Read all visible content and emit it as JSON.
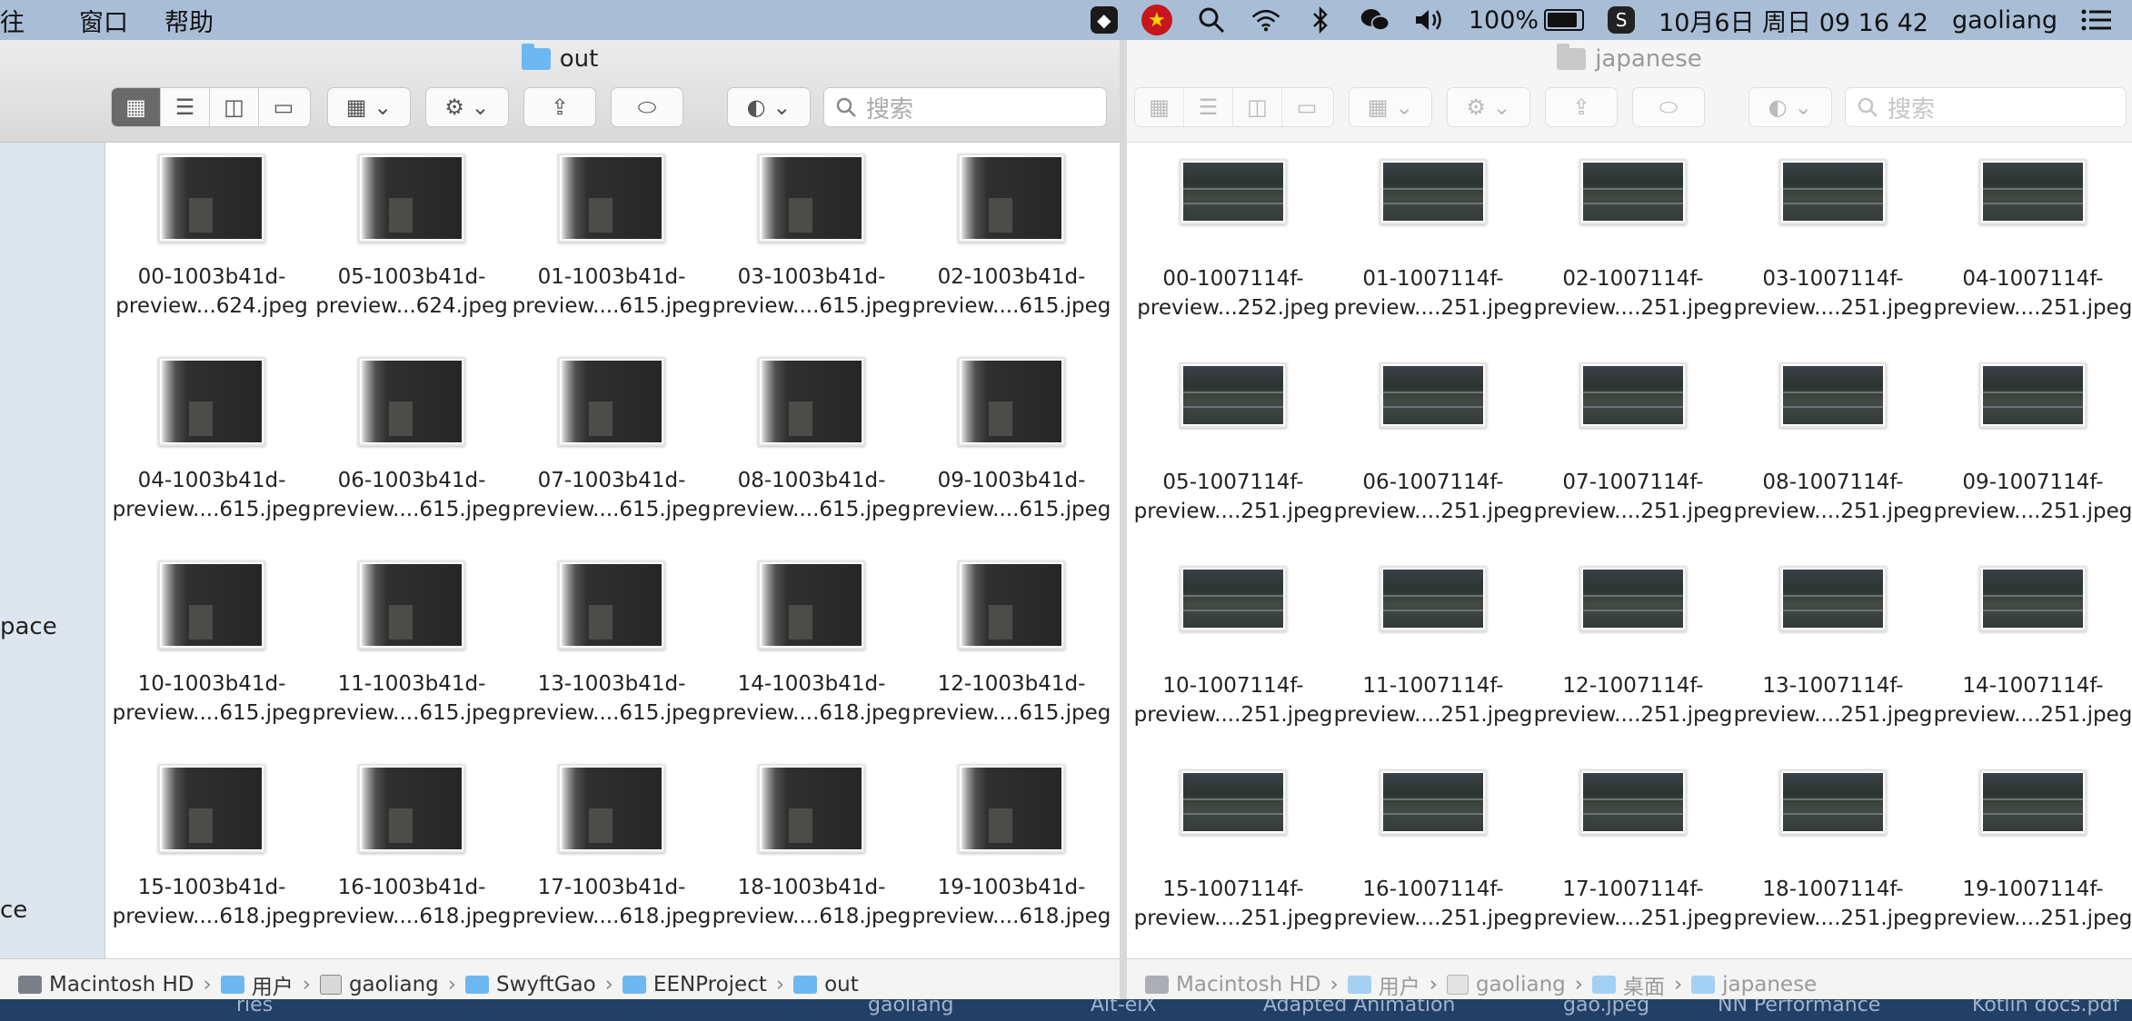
{
  "menubar": {
    "left_items": [
      "往",
      "窗口",
      "帮助"
    ],
    "battery": "100%",
    "datetime": "10月6日 周日  09 16 42",
    "user": "gaoliang"
  },
  "desktop_labels": [
    "ries",
    "gaoliang",
    "Alt-eiX",
    "Adapted Animation",
    "gao.jpeg",
    "NN Performance",
    "Kotlin docs.pdf"
  ],
  "left_window": {
    "title": "out",
    "search_placeholder": "搜索",
    "sidebar_items": [
      "pace",
      "ce"
    ],
    "files": [
      "00-1003b41d-|preview...624.jpeg",
      "05-1003b41d-|preview...624.jpeg",
      "01-1003b41d-|preview....615.jpeg",
      "03-1003b41d-|preview....615.jpeg",
      "02-1003b41d-|preview....615.jpeg",
      "04-1003b41d-|preview....615.jpeg",
      "06-1003b41d-|preview....615.jpeg",
      "07-1003b41d-|preview....615.jpeg",
      "08-1003b41d-|preview....615.jpeg",
      "09-1003b41d-|preview....615.jpeg",
      "10-1003b41d-|preview....615.jpeg",
      "11-1003b41d-|preview....615.jpeg",
      "13-1003b41d-|preview....615.jpeg",
      "14-1003b41d-|preview....618.jpeg",
      "12-1003b41d-|preview....615.jpeg",
      "15-1003b41d-|preview....618.jpeg",
      "16-1003b41d-|preview....618.jpeg",
      "17-1003b41d-|preview....618.jpeg",
      "18-1003b41d-|preview....618.jpeg",
      "19-1003b41d-|preview....618.jpeg"
    ],
    "path": [
      "Macintosh HD",
      "用户",
      "gaoliang",
      "SwyftGao",
      "EENProject",
      "out"
    ]
  },
  "right_window": {
    "title": "japanese",
    "search_placeholder": "搜索",
    "files": [
      "00-1007114f-|preview...252.jpeg",
      "01-1007114f-|preview....251.jpeg",
      "02-1007114f-|preview....251.jpeg",
      "03-1007114f-|preview....251.jpeg",
      "04-1007114f-|preview....251.jpeg",
      "05-1007114f-|preview....251.jpeg",
      "06-1007114f-|preview....251.jpeg",
      "07-1007114f-|preview....251.jpeg",
      "08-1007114f-|preview....251.jpeg",
      "09-1007114f-|preview....251.jpeg",
      "10-1007114f-|preview....251.jpeg",
      "11-1007114f-|preview....251.jpeg",
      "12-1007114f-|preview....251.jpeg",
      "13-1007114f-|preview....251.jpeg",
      "14-1007114f-|preview....251.jpeg",
      "15-1007114f-|preview....251.jpeg",
      "16-1007114f-|preview....251.jpeg",
      "17-1007114f-|preview....251.jpeg",
      "18-1007114f-|preview....251.jpeg",
      "19-1007114f-|preview....251.jpeg"
    ],
    "path": [
      "Macintosh HD",
      "用户",
      "gaoliang",
      "桌面",
      "japanese"
    ]
  }
}
